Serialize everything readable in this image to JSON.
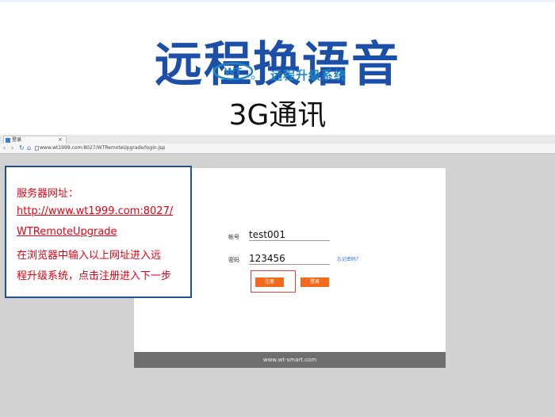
{
  "headline": "远程换语音",
  "subhead": "3G通讯",
  "browser": {
    "tab_title": "登录",
    "tab_close": "×",
    "url": "www.wt1999.com:8027/WTRemoteUpgrade/login.jsp"
  },
  "login": {
    "logo_text": "远程升级系统",
    "account_label": "帐号",
    "account_value": "test001",
    "password_label": "密码",
    "password_value": "123456",
    "forgot_link": "忘记密码？",
    "register_button": "注册",
    "login_button": "登录",
    "footer": "www.wt-smart.com"
  },
  "callout": {
    "line1": "服务器网址：",
    "line2": "http://www.wt1999.com:8027/",
    "line3": "WTRemoteUpgrade",
    "line4": "在浏览器中输入以上网址进入远",
    "line5": "程升级系统，点击注册进入下一步"
  },
  "colors": {
    "headline": "#1b4fa8",
    "accent_button": "#f26a1b",
    "callout_text": "#e60012",
    "callout_border": "#214f8f"
  },
  "icons": [
    "back-icon",
    "forward-icon",
    "refresh-icon",
    "home-icon",
    "page-icon",
    "wt-logo"
  ]
}
